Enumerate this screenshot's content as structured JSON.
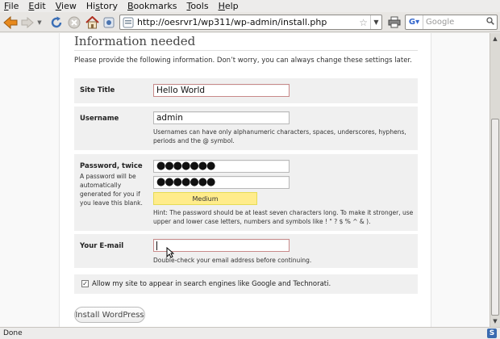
{
  "menu": {
    "items": [
      {
        "pre": "",
        "u": "F",
        "post": "ile"
      },
      {
        "pre": "",
        "u": "E",
        "post": "dit"
      },
      {
        "pre": "",
        "u": "V",
        "post": "iew"
      },
      {
        "pre": "Hi",
        "u": "s",
        "post": "tory"
      },
      {
        "pre": "",
        "u": "B",
        "post": "ookmarks"
      },
      {
        "pre": "",
        "u": "T",
        "post": "ools"
      },
      {
        "pre": "",
        "u": "H",
        "post": "elp"
      }
    ]
  },
  "toolbar": {
    "url": "http://oesrvr1/wp311/wp-admin/install.php",
    "search_placeholder": "Google"
  },
  "page": {
    "heading": "Information needed",
    "intro": "Please provide the following information. Don’t worry, you can always change these settings later.",
    "site_title_label": "Site Title",
    "site_title_value": "Hello World",
    "username_label": "Username",
    "username_value": "admin",
    "username_note": "Usernames can have only alphanumeric characters, spaces, underscores, hyphens, periods and the @ symbol.",
    "password_label": "Password, twice",
    "password_sublabel": "A password will be automatically generated for you if you leave this blank.",
    "password1_dots": "●●●●●●●",
    "password2_dots": "●●●●●●●",
    "strength_label": "Medium",
    "password_hint": "Hint: The password should be at least seven characters long. To make it stronger, use upper and lower case letters, numbers and symbols like ! \" ? $ % ^ & ).",
    "email_label": "Your E-mail",
    "email_value": "",
    "email_note": "Double-check your email address before continuing.",
    "privacy_label": "Allow my site to appear in search engines like Google and Technorati.",
    "privacy_checked": true,
    "install_button": "Install WordPress"
  },
  "status": {
    "text": "Done"
  },
  "colors": {
    "strength_bg": "#ffec8b",
    "row_bg": "#f0f0f0",
    "error_border": "#c88a8a"
  }
}
